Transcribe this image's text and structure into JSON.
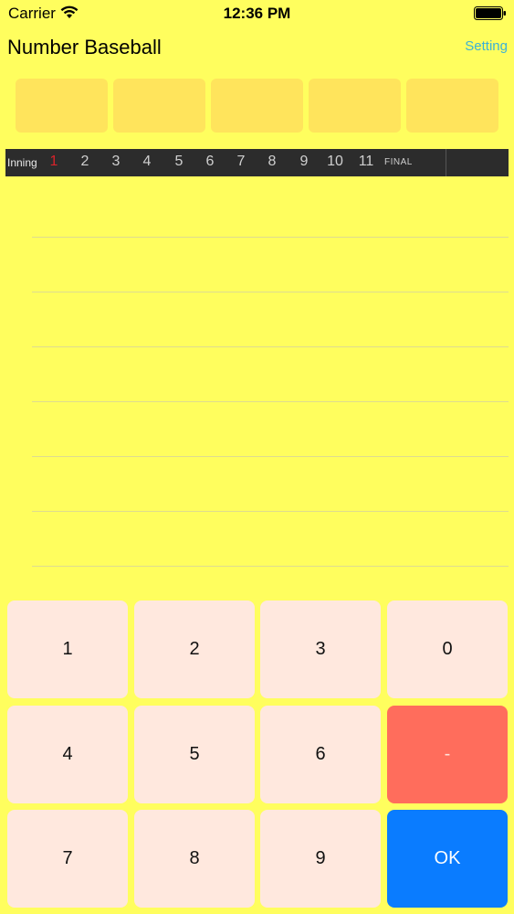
{
  "status_bar": {
    "carrier": "Carrier",
    "time": "12:36 PM"
  },
  "nav": {
    "title": "Number Baseball",
    "setting_label": "Setting"
  },
  "slots_count": 5,
  "inning_bar": {
    "label": "Inning",
    "innings": [
      "1",
      "2",
      "3",
      "4",
      "5",
      "6",
      "7",
      "8",
      "9",
      "10",
      "11"
    ],
    "current_index": 0,
    "final_label": "FINAL",
    "current_color": "#d8232a"
  },
  "keypad": {
    "keys": [
      {
        "label": "1",
        "name": "key-1"
      },
      {
        "label": "2",
        "name": "key-2"
      },
      {
        "label": "3",
        "name": "key-3"
      },
      {
        "label": "0",
        "name": "key-0"
      },
      {
        "label": "4",
        "name": "key-4"
      },
      {
        "label": "5",
        "name": "key-5"
      },
      {
        "label": "6",
        "name": "key-6"
      },
      {
        "label": "-",
        "name": "key-delete"
      },
      {
        "label": "7",
        "name": "key-7"
      },
      {
        "label": "8",
        "name": "key-8"
      },
      {
        "label": "9",
        "name": "key-9"
      },
      {
        "label": "OK",
        "name": "key-ok"
      }
    ]
  },
  "colors": {
    "background": "#fffe5e",
    "slot": "#ffe45c",
    "key": "#ffe8de",
    "delete_key": "#ff6d5c",
    "ok_key": "#0a7cff",
    "setting_link": "#3cb1d6"
  }
}
